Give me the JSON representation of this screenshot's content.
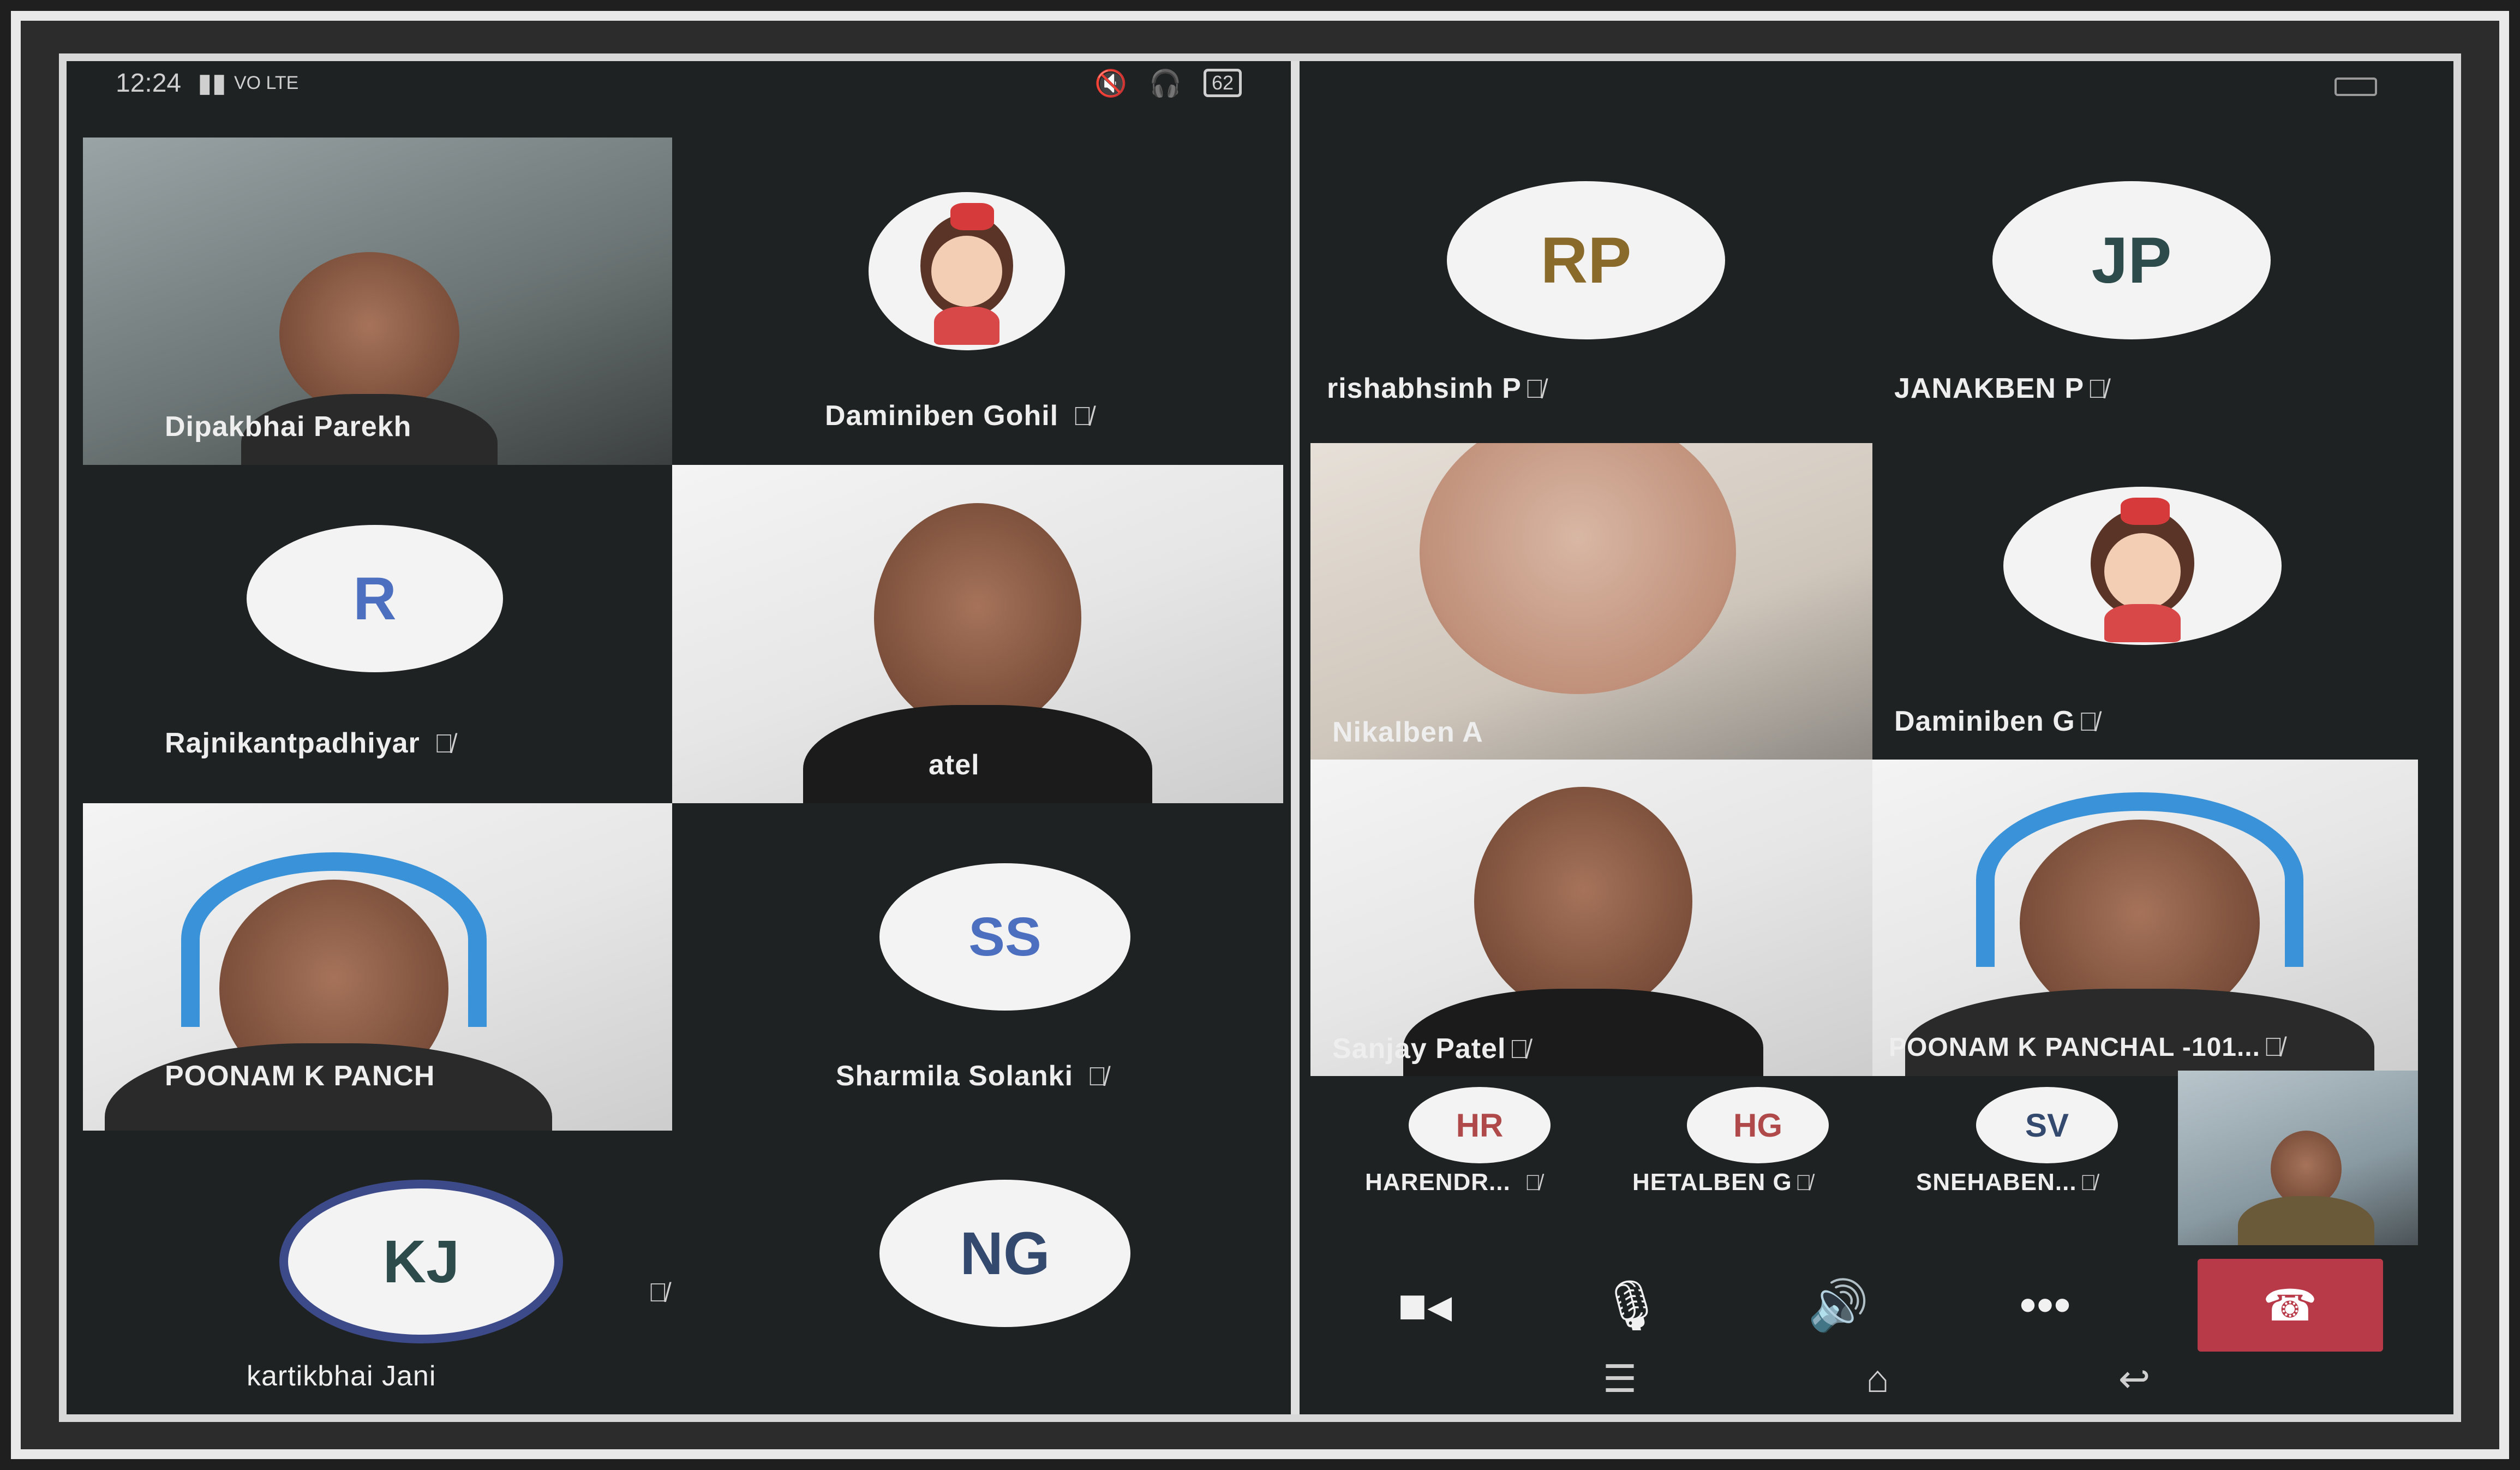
{
  "status_bar": {
    "time": "12:24",
    "network": "VO LTE",
    "battery": "62"
  },
  "left_panel": {
    "tiles": [
      {
        "name": "Dipakbhai Parekh"
      },
      {
        "name": "Daminiben Gohil",
        "muted": true
      },
      {
        "initials": "R",
        "name": "Rajnikantpadhiyar",
        "muted": true
      },
      {
        "name": "atel"
      },
      {
        "name": "POONAM K PANCH"
      },
      {
        "initials": "SS",
        "name": "Sharmila Solanki",
        "muted": true
      },
      {
        "initials": "KJ",
        "name": "kartikbhai Jani",
        "muted": true
      },
      {
        "initials": "NG"
      }
    ]
  },
  "right_panel": {
    "tiles": [
      {
        "initials": "RP",
        "name": "rishabhsinh P"
      },
      {
        "initials": "JP",
        "name": "JANAKBEN P"
      },
      {
        "name": "Nikalben A"
      },
      {
        "name": "Daminiben G"
      },
      {
        "name": "Sanjay Patel"
      },
      {
        "name": "POONAM K PANCHAL -101..."
      }
    ],
    "strip": [
      {
        "initials": "HR",
        "name": "HARENDR..."
      },
      {
        "initials": "HG",
        "name": "HETALBEN G"
      },
      {
        "initials": "SV",
        "name": "SNEHABEN..."
      }
    ],
    "controls": [
      "camera-icon",
      "microphone-icon",
      "speaker-icon",
      "more-icon",
      "hang-up-icon"
    ]
  },
  "mic_glyph": "🎙̸",
  "colors": {
    "hangup": "#b83a48",
    "headset": "#3a92d8",
    "avatar_bg": "#f3f3f3"
  }
}
